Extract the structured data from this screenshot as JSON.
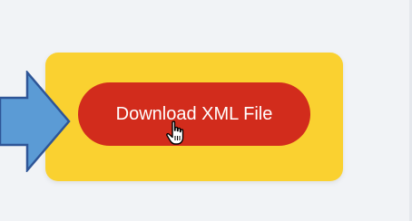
{
  "button": {
    "label": "Download XML File"
  },
  "icons": {
    "arrow": "right-arrow-icon",
    "cursor": "hand-pointer-icon"
  },
  "colors": {
    "background": "#f1f3f6",
    "card": "#fad130",
    "button": "#d22c1c",
    "button_text": "#ffffff",
    "arrow_fill": "#5b9bd5",
    "arrow_stroke": "#2e5597"
  }
}
